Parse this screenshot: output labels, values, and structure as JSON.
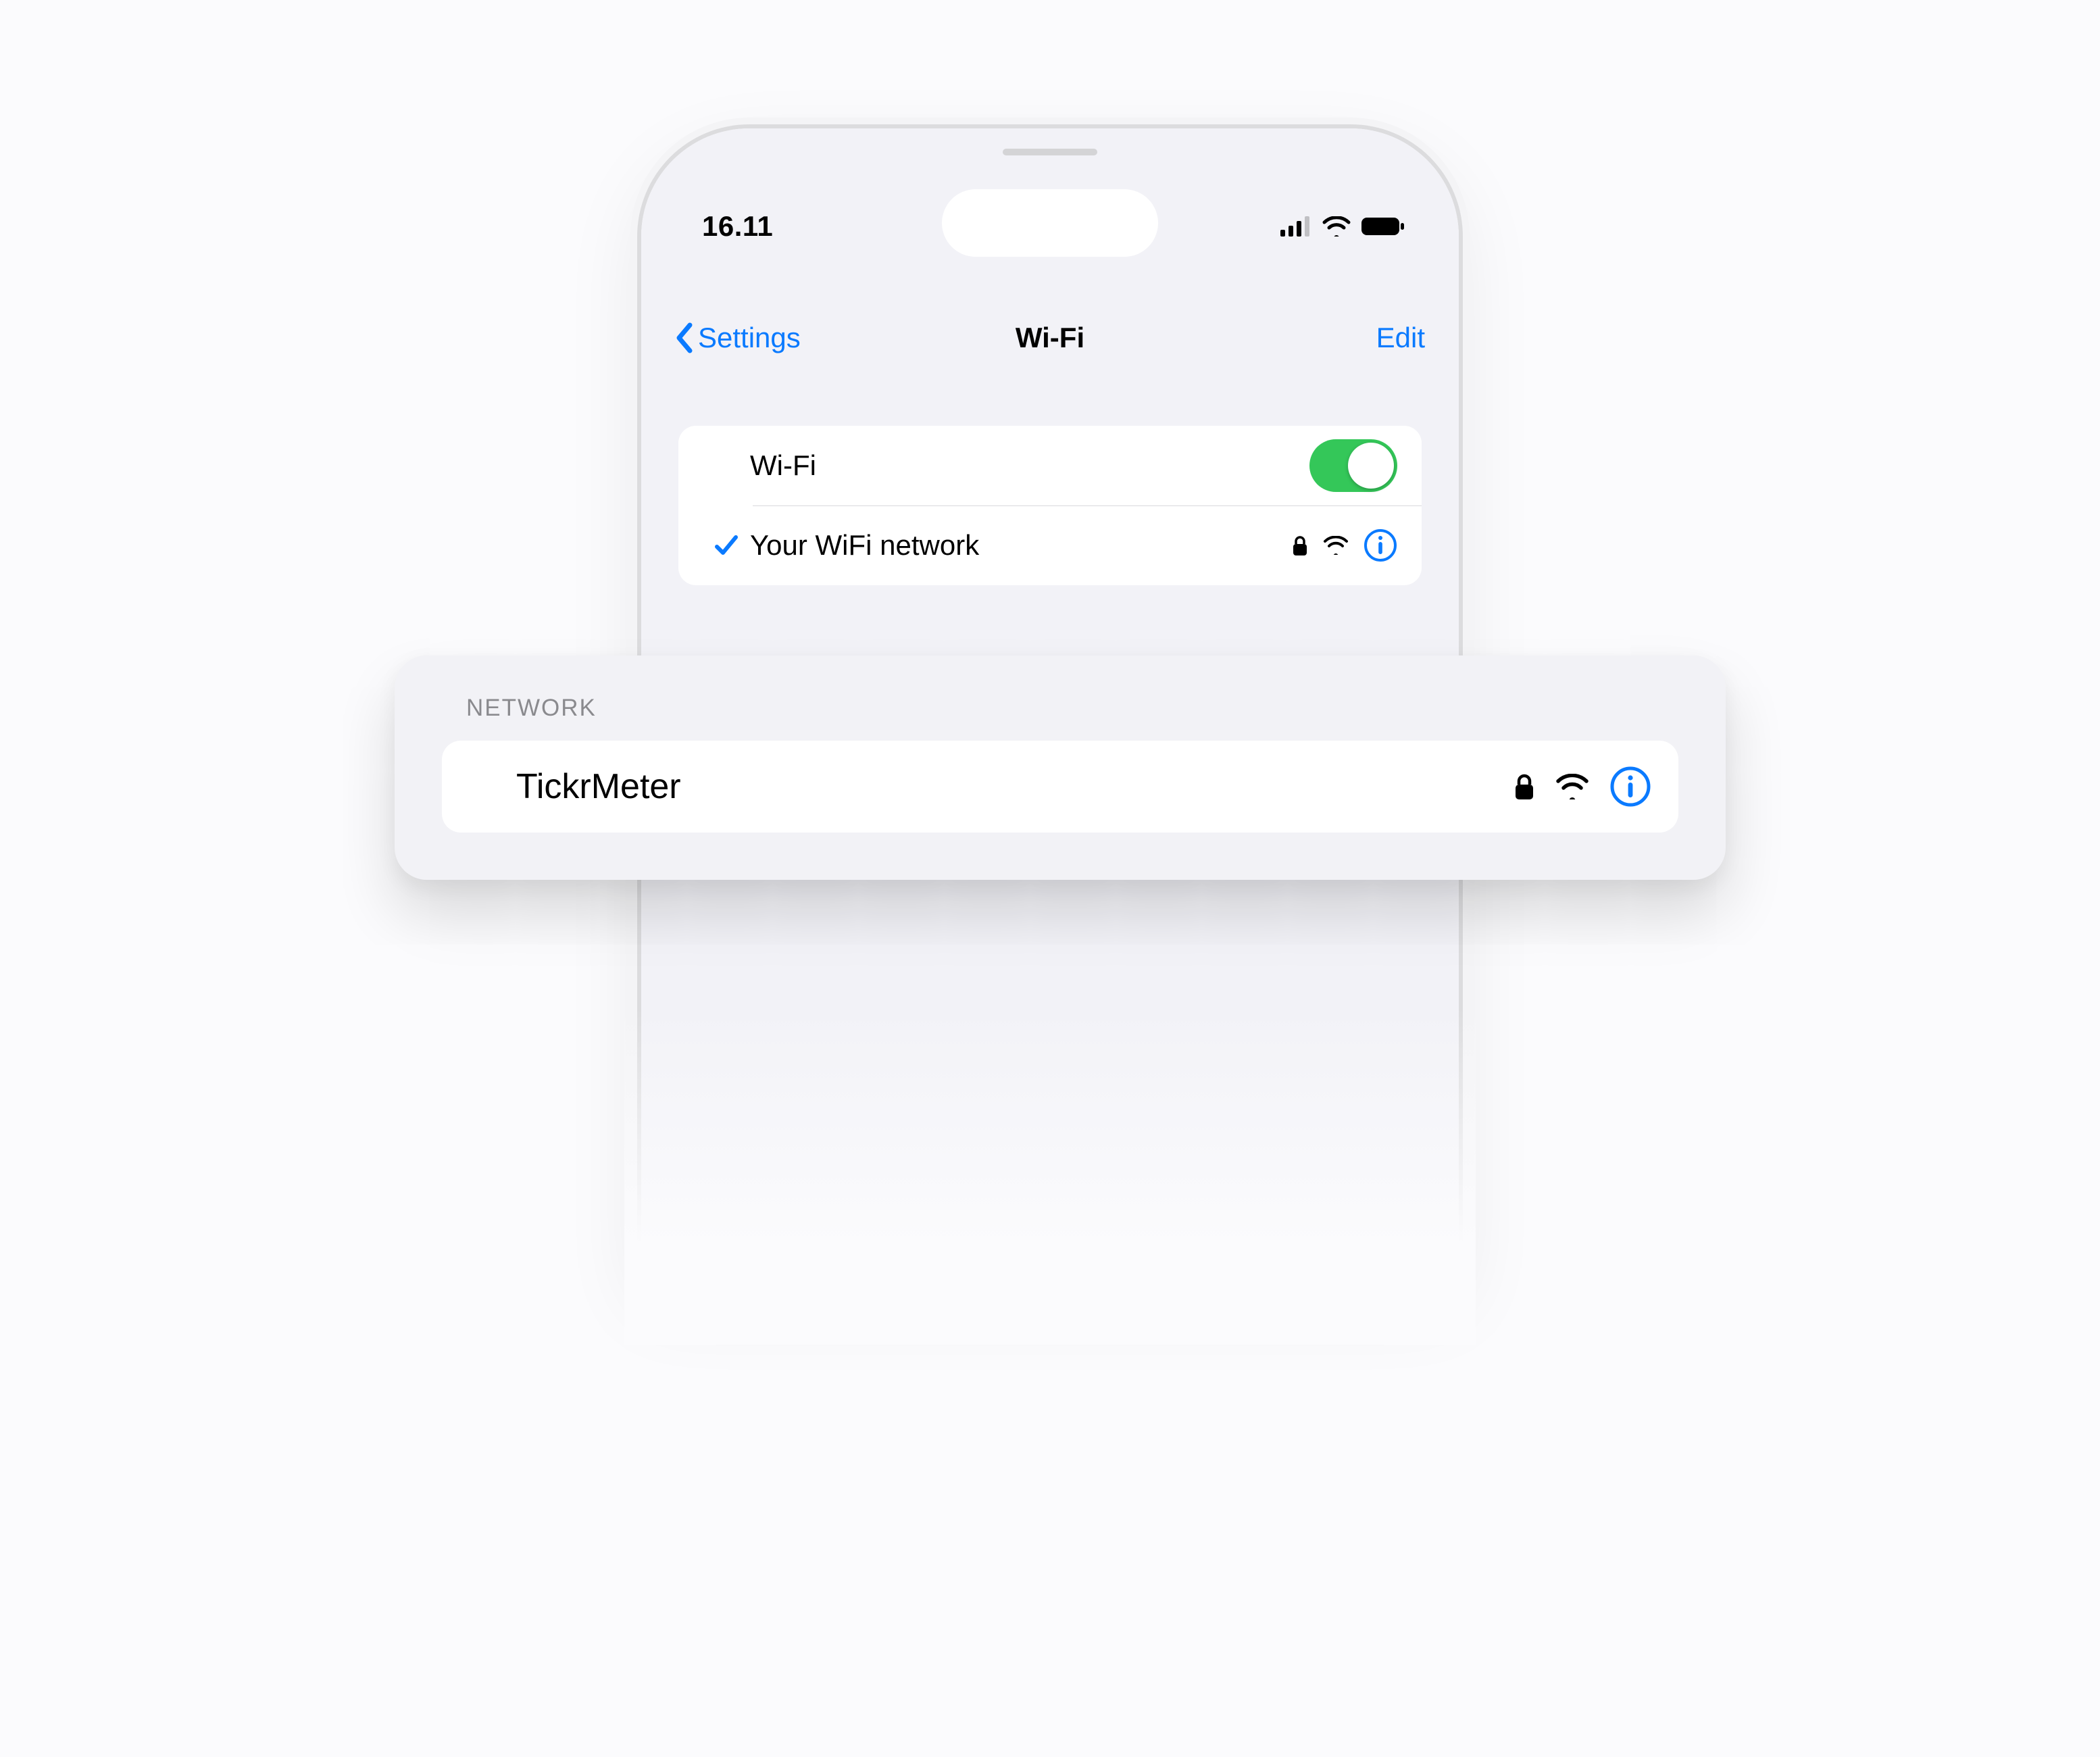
{
  "status": {
    "time": "16.11"
  },
  "nav": {
    "back_label": "Settings",
    "title": "Wi-Fi",
    "edit_label": "Edit"
  },
  "wifi": {
    "toggle_label": "Wi-Fi",
    "toggle_on": true,
    "connected_network": "Your WiFi network"
  },
  "popover": {
    "section_header": "NETWORK",
    "network_name": "TickrMeter"
  },
  "colors": {
    "ios_blue": "#0a7aff",
    "toggle_green": "#34c759"
  }
}
